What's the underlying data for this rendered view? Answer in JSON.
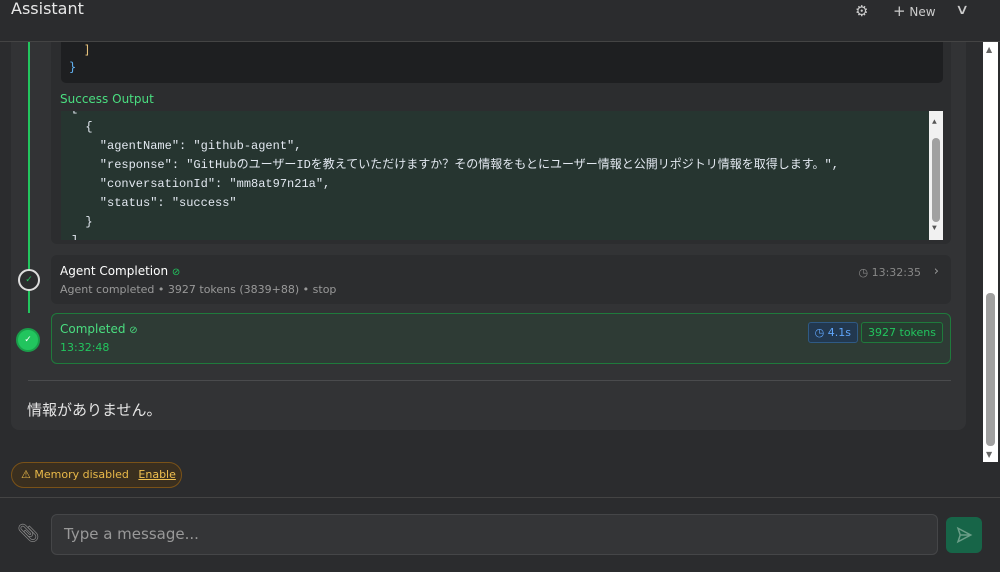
{
  "header": {
    "title": "Assistant",
    "new_label": "New"
  },
  "tool": {
    "code_tail": [
      "  ]",
      "}"
    ],
    "success_label": "Success Output",
    "success_lines": [
      "[",
      "  {",
      "    \"agentName\": \"github-agent\",",
      "    \"response\": \"GitHubのユーザーIDを教えていただけますか？その情報をもとにユーザー情報と公開リポジトリ情報を取得します。\",",
      "    \"conversationId\": \"mm8at97n21a\",",
      "    \"status\": \"success\"",
      "  }",
      "]"
    ]
  },
  "steps": [
    {
      "title": "Agent Completion",
      "subtitle": "Agent completed • 3927 tokens (3839+88) • stop",
      "time": "13:32:35"
    },
    {
      "title": "Completed",
      "time": "13:32:48",
      "duration": "4.1s",
      "tokens": "3927 tokens"
    }
  ],
  "message": "情報がありません。",
  "memory": {
    "label": "Memory disabled",
    "action": "Enable"
  },
  "composer": {
    "placeholder": "Type a message..."
  }
}
